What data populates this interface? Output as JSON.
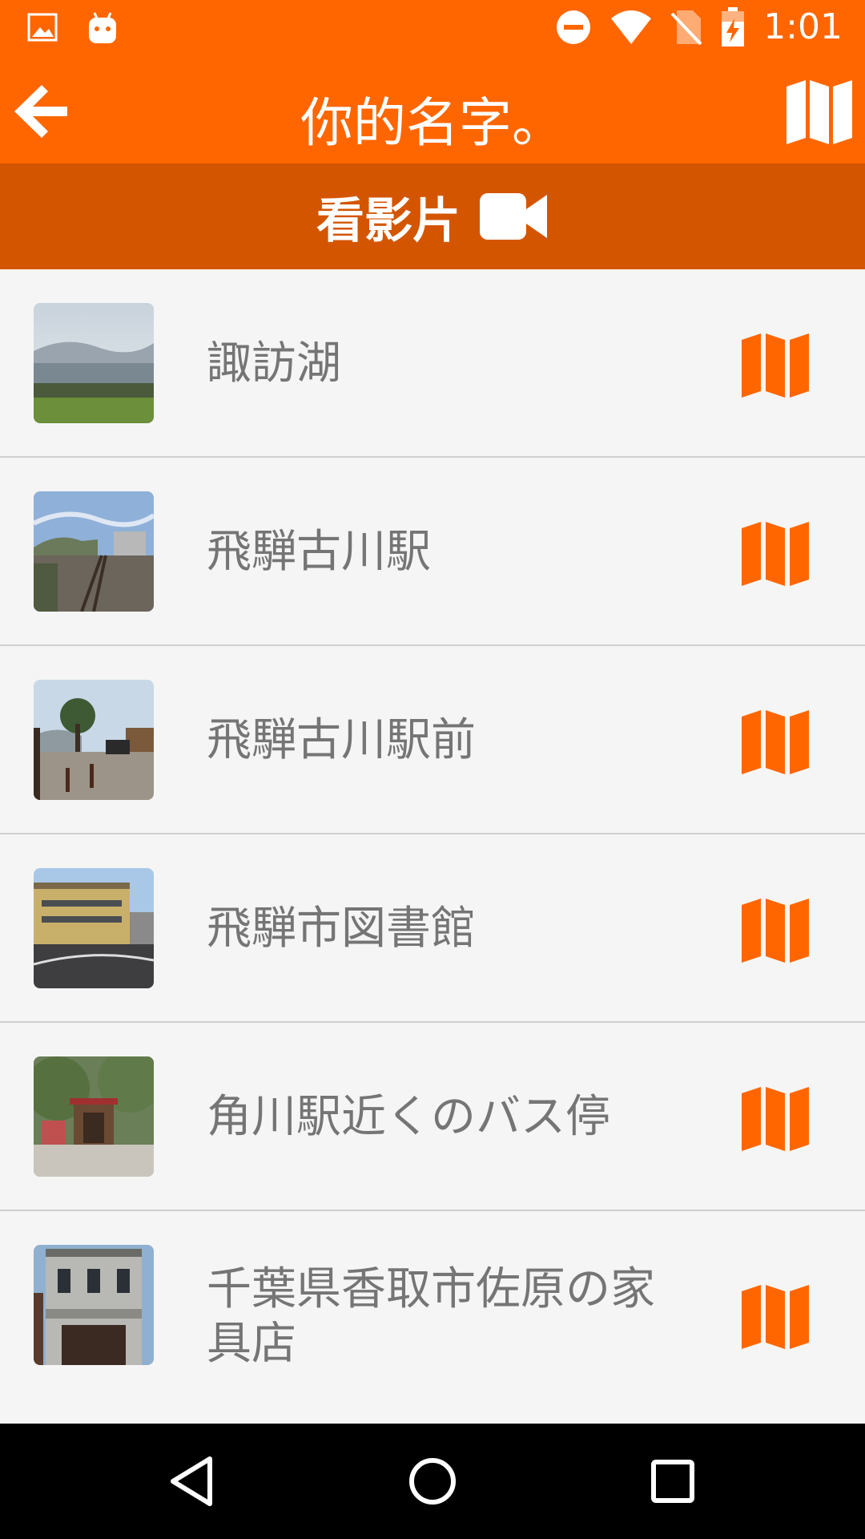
{
  "status_bar": {
    "time": "1:01",
    "icons": [
      "image-icon",
      "android-icon",
      "do-not-disturb-icon",
      "wifi-icon",
      "no-sim-icon",
      "battery-charging-icon"
    ]
  },
  "app_bar": {
    "title": "你的名字。",
    "back_icon": "arrow-left-icon",
    "map_icon": "map-icon"
  },
  "video_bar": {
    "label": "看影片",
    "icon": "video-camera-icon"
  },
  "locations": [
    {
      "name": "諏訪湖"
    },
    {
      "name": "飛騨古川駅"
    },
    {
      "name": "飛騨古川駅前"
    },
    {
      "name": "飛騨市図書館"
    },
    {
      "name": "角川駅近くのバス停"
    },
    {
      "name": "千葉県香取市佐原の家具店"
    }
  ],
  "nav_bar": {
    "icons": [
      "back-triangle-icon",
      "home-circle-icon",
      "recents-square-icon"
    ]
  },
  "colors": {
    "primary": "#ff6600",
    "primary_dark": "#d45500",
    "list_bg": "#f5f5f5",
    "divider": "#cfcfcf",
    "text_gray": "#757575"
  }
}
